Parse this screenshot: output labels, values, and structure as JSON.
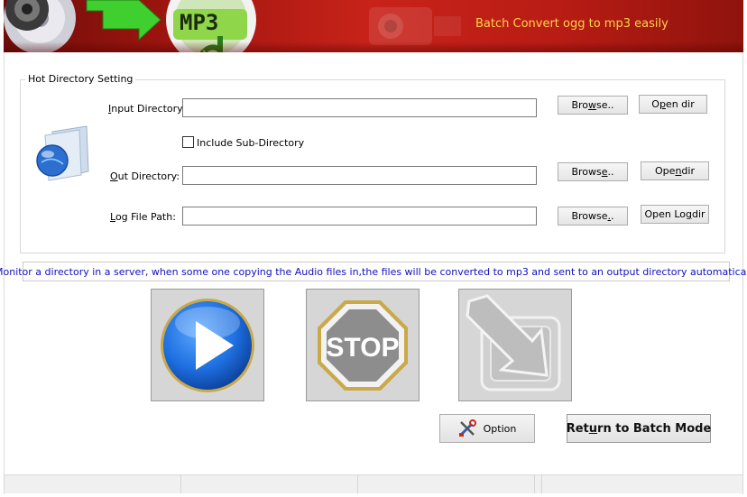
{
  "banner": {
    "title": "Batch Convert  ogg to mp3 easily",
    "badge": "MP3"
  },
  "group": {
    "legend": "Hot Directory Setting"
  },
  "input_dir": {
    "label_key": "I",
    "label_rest": "nput Directory:",
    "value": "",
    "browse_pre": "Bro",
    "browse_key": "w",
    "browse_post": "se..",
    "open_pre": "O",
    "open_key": "p",
    "open_post": "en dir"
  },
  "include_sub": {
    "label": "Include Sub-Directory",
    "checked": false
  },
  "out_dir": {
    "label_key": "O",
    "label_rest": "ut Directory:",
    "value": "",
    "browse_pre": "Brows",
    "browse_key": "e",
    "browse_post": "..",
    "open_pre": "Ope",
    "open_key": "n",
    "open_post": " dir"
  },
  "log_path": {
    "label_key": "L",
    "label_rest": "og File Path:",
    "value": "",
    "browse_pre": "Browse",
    "browse_key": ".",
    "browse_post": ".",
    "open_pre": "Open Lo",
    "open_key": "g",
    "open_post": "dir"
  },
  "info": {
    "text": "Monitor a directory in a server, when some one copying the Audio files in,the files will be converted to mp3 and sent to an output directory automatically"
  },
  "actions": {
    "stop_text": "STOP",
    "option_label": "Option",
    "return_pre": "Ret",
    "return_key": "u",
    "return_post": "rn to Batch Mode"
  },
  "colors": {
    "banner_red": "#c8231a",
    "banner_text": "#ffd24a",
    "info_text": "#1010c0",
    "play_blue": "#1e6fe0",
    "stop_gray": "#8d8d8d"
  }
}
